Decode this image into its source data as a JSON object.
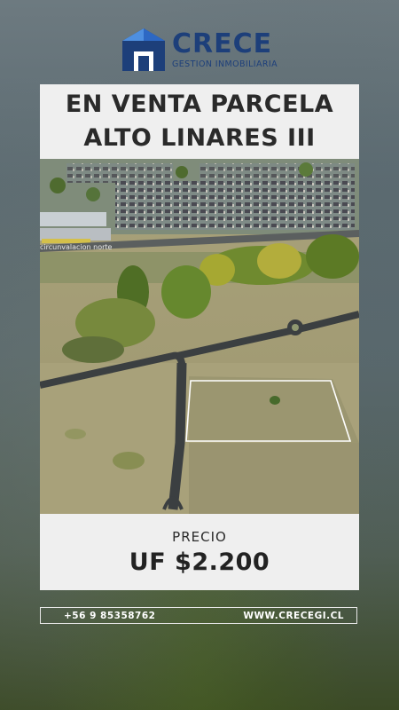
{
  "brand": {
    "name": "CRECE",
    "subtitle": "GESTION INMOBILIARIA",
    "color": "#1d3f7a",
    "icon": "house-logo-icon"
  },
  "listing": {
    "title_line1": "EN VENTA PARCELA",
    "title_line2": "ALTO LINARES III",
    "sign_text": "circunvalacion norte",
    "price_label": "PRECIO",
    "price_value": "UF $2.200"
  },
  "contact": {
    "phone": "+56 9 85358762",
    "website": "WWW.CRECEGI.CL"
  }
}
